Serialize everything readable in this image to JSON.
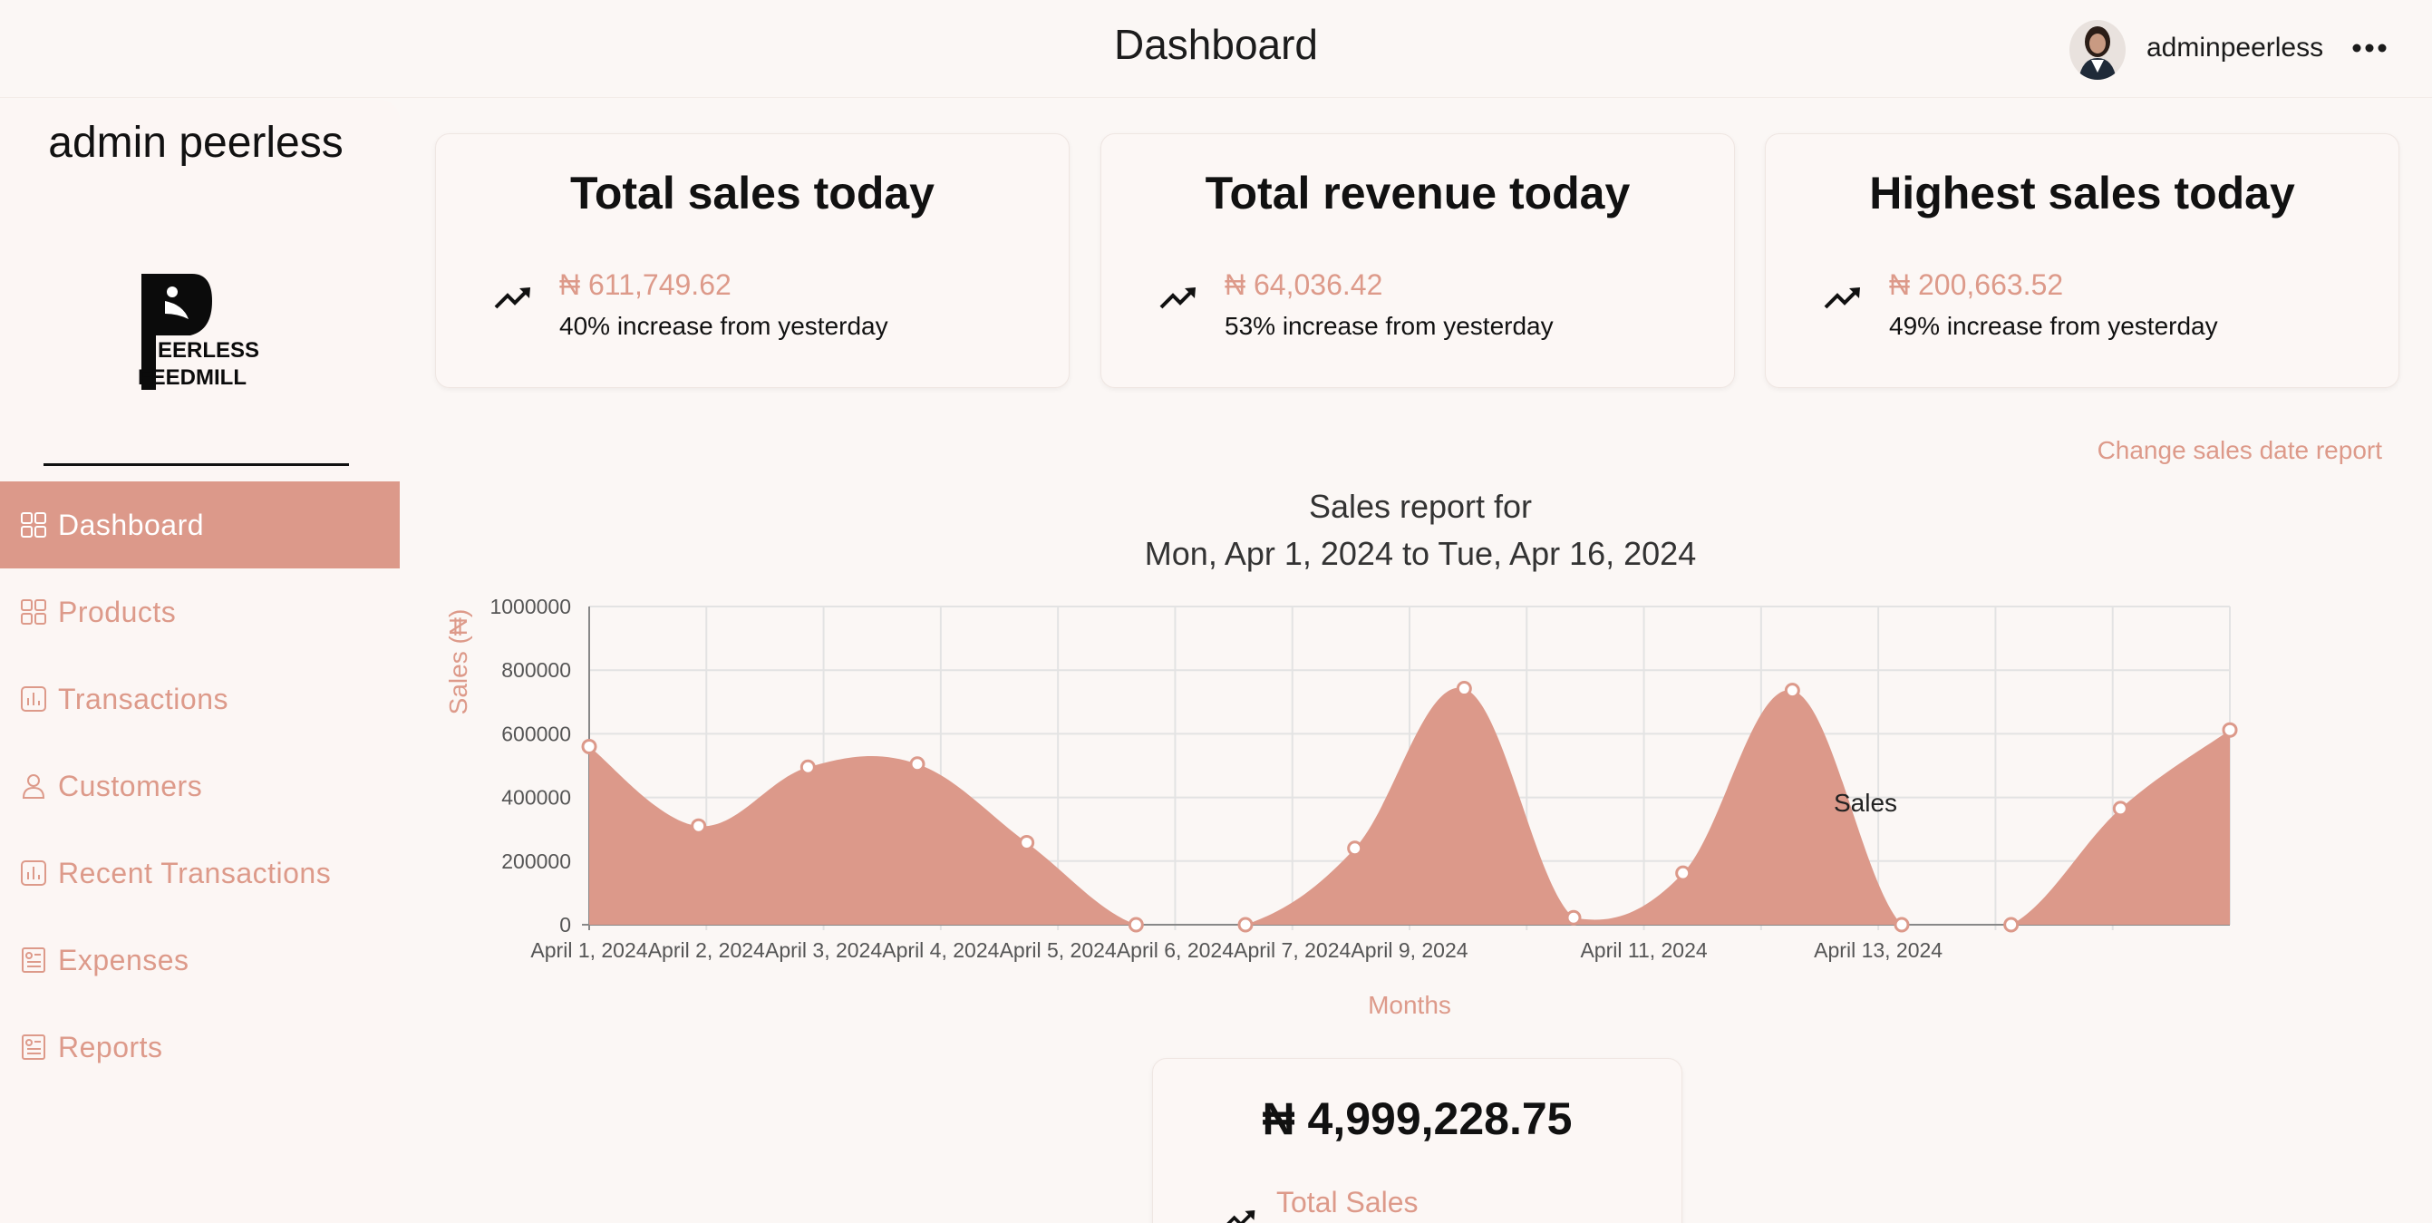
{
  "header": {
    "title": "Dashboard",
    "username": "adminpeerless",
    "more_icon": "more-horizontal-icon"
  },
  "sidebar": {
    "brand_name": "admin peerless",
    "logo_text": [
      "EERLESS",
      "FEEDMILL"
    ],
    "items": [
      {
        "label": "Dashboard",
        "icon": "grid-icon",
        "active": true
      },
      {
        "label": "Products",
        "icon": "grid-icon",
        "active": false
      },
      {
        "label": "Transactions",
        "icon": "bar-chart-icon",
        "active": false
      },
      {
        "label": "Customers",
        "icon": "user-icon",
        "active": false
      },
      {
        "label": "Recent Transactions",
        "icon": "bar-chart-icon",
        "active": false
      },
      {
        "label": "Expenses",
        "icon": "report-icon",
        "active": false
      },
      {
        "label": "Reports",
        "icon": "report-icon",
        "active": false
      }
    ]
  },
  "stats": [
    {
      "title": "Total sales today",
      "amount": "₦ 611,749.62",
      "change": "40% increase from yesterday",
      "icon": "trending-up-icon"
    },
    {
      "title": "Total revenue today",
      "amount": "₦ 64,036.42",
      "change": "53% increase from yesterday",
      "icon": "trending-up-icon"
    },
    {
      "title": "Highest sales today",
      "amount": "₦ 200,663.52",
      "change": "49% increase from yesterday",
      "icon": "trending-up-icon"
    }
  ],
  "change_report_label": "Change sales date report",
  "colors": {
    "accent": "#dc998a",
    "accent_text": "#dd9a8a",
    "background": "#fbf7f5"
  },
  "chart_data": {
    "type": "area",
    "title": [
      "Sales report for",
      "Mon, Apr 1, 2024 to Tue, Apr 16, 2024"
    ],
    "xlabel": "Months",
    "ylabel": "Sales (₦)",
    "ylim": [
      0,
      1000000
    ],
    "yticks": [
      "0",
      "200000",
      "400000",
      "600000",
      "800000",
      "1000000"
    ],
    "tick_labels": [
      "April 1, 2024",
      "April 2, 2024",
      "April 3, 2024",
      "April 4, 2024",
      "April 5, 2024",
      "April 6, 2024",
      "April 7, 2024",
      "April 9, 2024",
      "",
      "April 11, 2024",
      "",
      "April 13, 2024",
      "",
      ""
    ],
    "values": [
      560000,
      310000,
      495000,
      505000,
      258000,
      0,
      0,
      240000,
      742000,
      22000,
      162000,
      736000,
      0,
      0,
      365000,
      612000
    ],
    "grid": true,
    "legend_position": "right",
    "series": [
      {
        "name": "Sales",
        "values": [
          560000,
          310000,
          495000,
          505000,
          258000,
          0,
          0,
          240000,
          742000,
          22000,
          162000,
          736000,
          0,
          0,
          365000,
          612000
        ]
      }
    ]
  },
  "total_card": {
    "amount": "₦ 4,999,228.75",
    "label": "Total Sales",
    "icon": "trending-up-icon"
  }
}
